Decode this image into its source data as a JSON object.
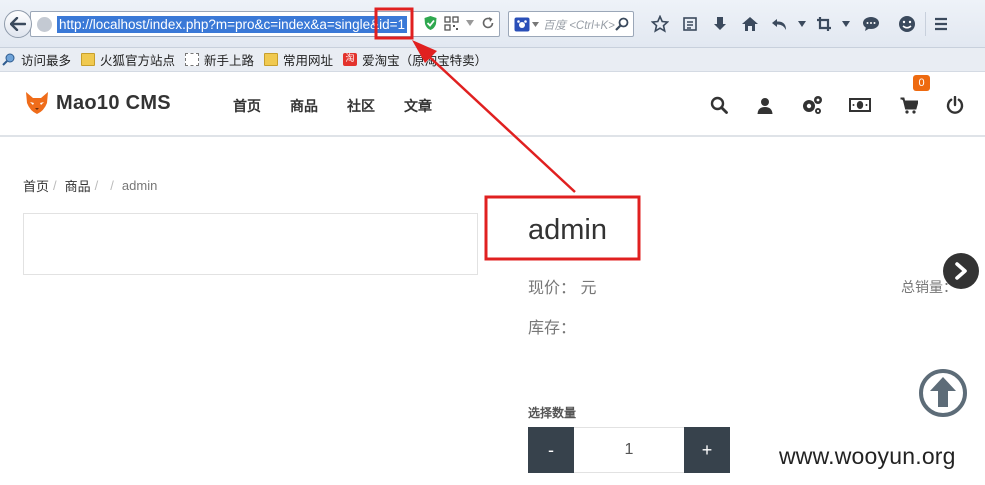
{
  "browser": {
    "url": "http://localhost/index.php?m=pro&c=index&a=single&id=1",
    "search_placeholder": "百度 <Ctrl+K>",
    "icons": [
      "back-arrow-icon",
      "globe-icon",
      "shield-check-icon",
      "qr-code-icon",
      "dropdown-icon",
      "reload-icon",
      "search-engine-icon",
      "search-icon",
      "star-icon",
      "reading-list-icon",
      "download-icon",
      "home-icon",
      "undo-icon",
      "crop-icon",
      "chat-icon",
      "emoji-icon",
      "menu-icon"
    ],
    "bookmarks": [
      {
        "label": "访问最多",
        "icon": "pin-icon"
      },
      {
        "label": "火狐官方站点",
        "icon": "folder-icon"
      },
      {
        "label": "新手上路",
        "icon": "dashed-page-icon"
      },
      {
        "label": "常用网址",
        "icon": "folder-icon"
      },
      {
        "label": "爱淘宝（原淘宝特卖）",
        "icon": "taobao-icon",
        "icon_text": "淘"
      }
    ]
  },
  "site": {
    "logo_text": "Mao10 CMS",
    "nav": [
      "首页",
      "商品",
      "社区",
      "文章"
    ],
    "header_icons": [
      "search-icon",
      "user-icon",
      "settings-icon",
      "money-icon",
      "cart-icon",
      "power-icon"
    ],
    "cart_count": "0"
  },
  "breadcrumb": {
    "items": [
      "首页",
      "商品",
      ""
    ],
    "current": "admin"
  },
  "product": {
    "title": "admin",
    "price_label": "现价：",
    "price_unit": "元",
    "stock_label": "库存：",
    "sales_label": "总销量：",
    "qty_label": "选择数量",
    "qty_minus": "-",
    "qty_value": "1",
    "qty_plus": "+"
  },
  "watermark": "www.wooyun.org",
  "colors": {
    "accent_orange": "#ee6a10",
    "annotation_red": "#e02020",
    "url_highlight": "#3a79d7",
    "qty_button": "#37424c"
  }
}
